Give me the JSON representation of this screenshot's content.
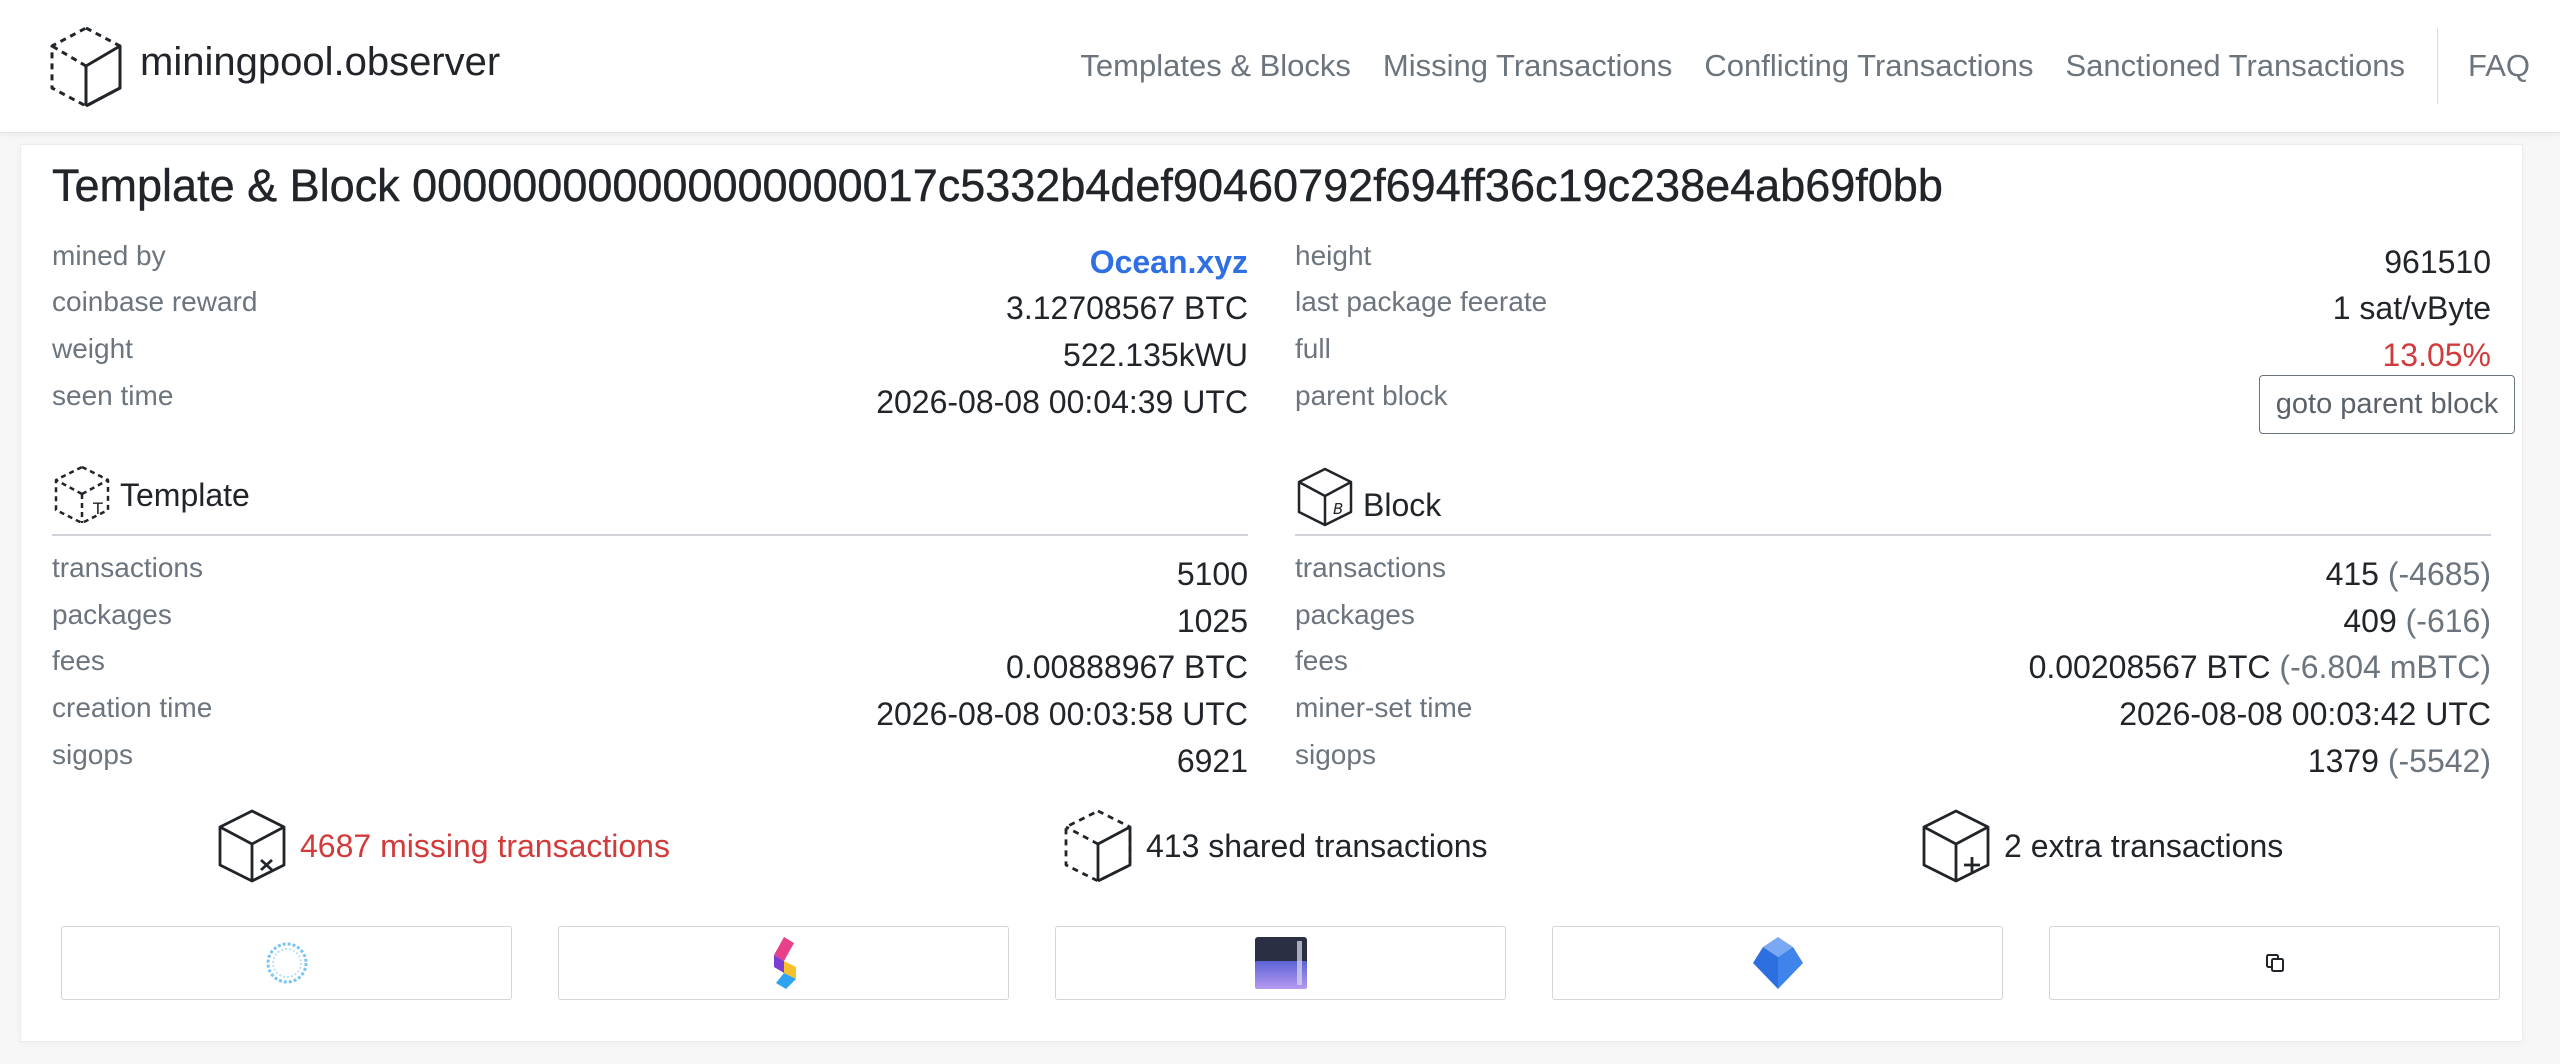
{
  "brand": {
    "name": "miningpool.observer",
    "icon": "cube-outline-icon"
  },
  "nav": {
    "links": [
      "Templates & Blocks",
      "Missing Transactions",
      "Conflicting Transactions",
      "Sanctioned Transactions"
    ],
    "faq": "FAQ"
  },
  "title": "Template & Block 000000000000000000017c5332b4def90460792f694ff36c19c238e4ab69f0bb",
  "overview_left": [
    {
      "label": "mined by",
      "value": "Ocean.xyz"
    },
    {
      "label": "coinbase reward",
      "value": "3.12708567 BTC"
    },
    {
      "label": "weight",
      "value": "522.135kWU"
    },
    {
      "label": "seen time",
      "value": "2026-08-08 00:04:39 UTC"
    }
  ],
  "overview_right": [
    {
      "label": "height",
      "value": "961510"
    },
    {
      "label": "last package feerate",
      "value": "1 sat/vByte"
    },
    {
      "label": "full",
      "value": "13.05%"
    },
    {
      "label": "parent block",
      "button": "goto parent block"
    }
  ],
  "template": {
    "heading": "Template",
    "icon": "template-cube-icon",
    "rows": [
      {
        "label": "transactions",
        "value": "5100"
      },
      {
        "label": "packages",
        "value": "1025"
      },
      {
        "label": "fees",
        "value": "0.00888967 BTC"
      },
      {
        "label": "creation time",
        "value": "2026-08-08 00:03:58 UTC"
      },
      {
        "label": "sigops",
        "value": "6921"
      }
    ]
  },
  "block": {
    "heading": "Block",
    "icon": "block-cube-icon",
    "rows": [
      {
        "label": "transactions",
        "value": "415",
        "diff": "(-4685)"
      },
      {
        "label": "packages",
        "value": "409",
        "diff": "(-616)"
      },
      {
        "label": "fees",
        "value": "0.00208567 BTC",
        "diff": "(-6.804 mBTC)"
      },
      {
        "label": "miner-set time",
        "value": "2026-08-08 00:03:42 UTC",
        "diff": ""
      },
      {
        "label": "sigops",
        "value": "1379",
        "diff": "(-5542)"
      }
    ]
  },
  "summary": {
    "missing": "4687 missing transactions",
    "shared": "413 shared transactions",
    "extra": "2 extra transactions"
  },
  "colors": {
    "accent_link": "#2f6fe4",
    "warning_red": "#d23b3b",
    "muted": "#6c757d"
  },
  "explorer_icons": [
    "mempool-ring-icon",
    "explorer-s-logo-icon",
    "explorer-gradient-box-icon",
    "explorer-diamond-logo-icon",
    "copy-icon"
  ]
}
